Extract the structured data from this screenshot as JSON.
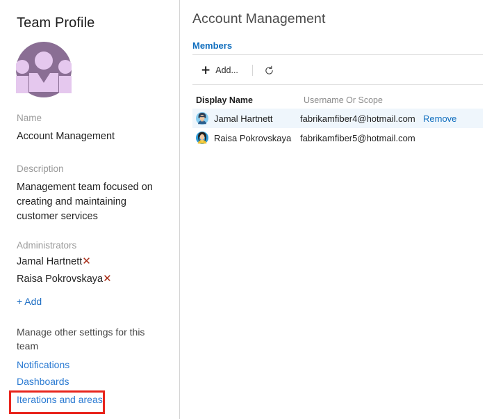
{
  "sidebar": {
    "title": "Team Profile",
    "avatar_icon": "team-group-avatar-icon",
    "avatar_bg_color": "#8a6e94",
    "avatar_fg_color": "#e5c8ee",
    "name": {
      "label": "Name",
      "value": "Account Management"
    },
    "description": {
      "label": "Description",
      "value": "Management team focused on creating and maintaining customer services"
    },
    "administrators": {
      "label": "Administrators",
      "remove_icon": "remove-x-icon",
      "remove_icon_glyph": "✕",
      "remove_icon_color": "#a62a14",
      "items": [
        {
          "name": "Jamal Hartnett"
        },
        {
          "name": "Raisa Pokrovskaya"
        }
      ],
      "add_label": "+ Add"
    },
    "manage_text": "Manage other settings for this team",
    "links": [
      {
        "label": "Notifications",
        "highlighted": false
      },
      {
        "label": "Dashboards",
        "highlighted": false
      },
      {
        "label": "Iterations and areas",
        "highlighted": true
      }
    ],
    "highlight_color": "#e8251d",
    "link_color": "#2a7ad2"
  },
  "main": {
    "title": "Account Management",
    "tab": {
      "label": "Members",
      "active": true,
      "color": "#106ebe"
    },
    "toolbar": {
      "add_icon": "plus-icon",
      "add_label": "Add...",
      "refresh_icon": "refresh-icon"
    },
    "table": {
      "columns": [
        "Display Name",
        "Username Or Scope"
      ],
      "action_label": "Remove",
      "rows": [
        {
          "avatar_icon": "user-avatar-male-icon",
          "display_name": "Jamal Hartnett",
          "username": "fabrikamfiber4@hotmail.com",
          "action": "Remove",
          "selected": true
        },
        {
          "avatar_icon": "user-avatar-female-icon",
          "display_name": "Raisa Pokrovskaya",
          "username": "fabrikamfiber5@hotmail.com",
          "action": "",
          "selected": false
        }
      ]
    },
    "row_highlight_color": "#eff6fc"
  }
}
